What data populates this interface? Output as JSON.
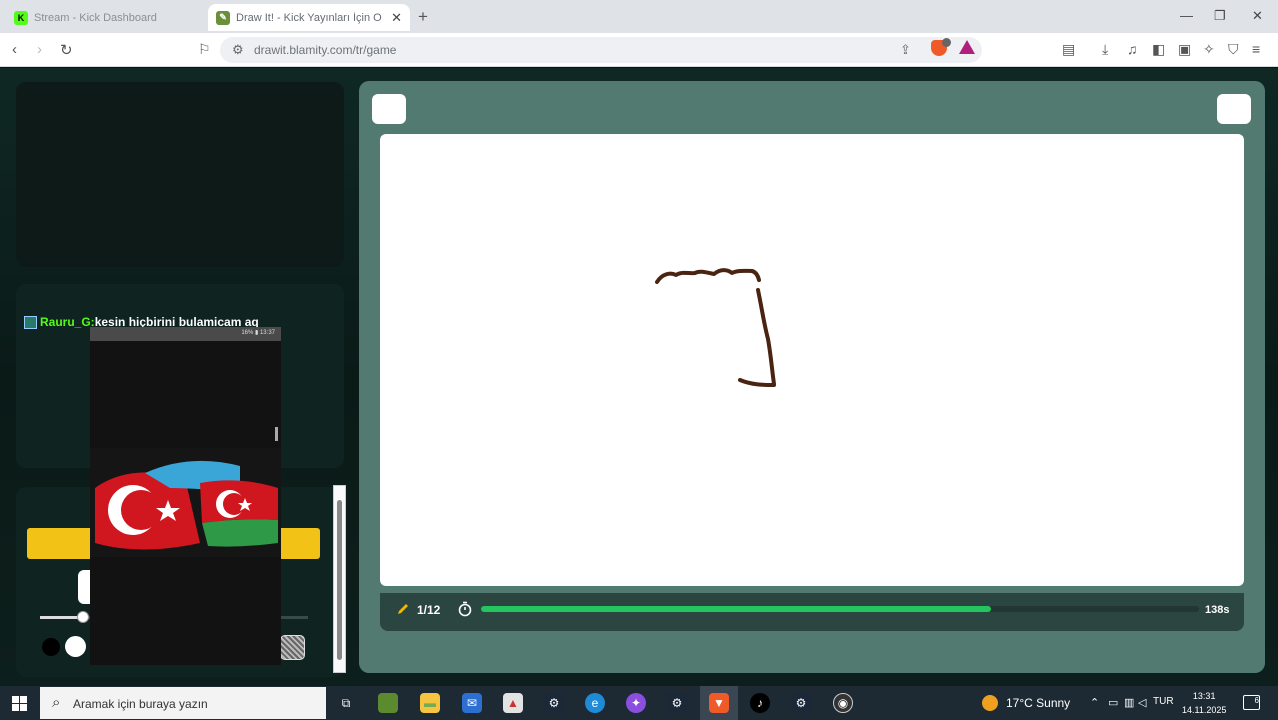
{
  "browser": {
    "tabs": [
      {
        "title": "Stream - Kick Dashboard",
        "favicon": "kick-icon",
        "active": false
      },
      {
        "title": "Draw It! - Kick Yayınları İçin O",
        "favicon": "drawit-icon",
        "active": true
      }
    ],
    "new_tab": "+",
    "url": "drawit.blamity.com/tr/game"
  },
  "left": {
    "chat": {
      "badge": "",
      "user": "Rauru_G:",
      "message": "kesin hiçbirini bulamicam aq"
    },
    "brush_size": 0.15,
    "colors": [
      "#000000",
      "#ffffff"
    ],
    "accent": "#f2c316"
  },
  "phone": {
    "status_text": "16% ▮ 13:37"
  },
  "game": {
    "round": "1/12",
    "timer": "138s",
    "progress": 0.71,
    "stroke_color": "#4a2411",
    "progress_color": "#22c55e"
  },
  "taskbar": {
    "search_placeholder": "Aramak için buraya yazın",
    "weather": "17°C  Sunny",
    "lang": "TUR",
    "time": "13:31",
    "date": "14.11.2025",
    "notifications": "6"
  }
}
